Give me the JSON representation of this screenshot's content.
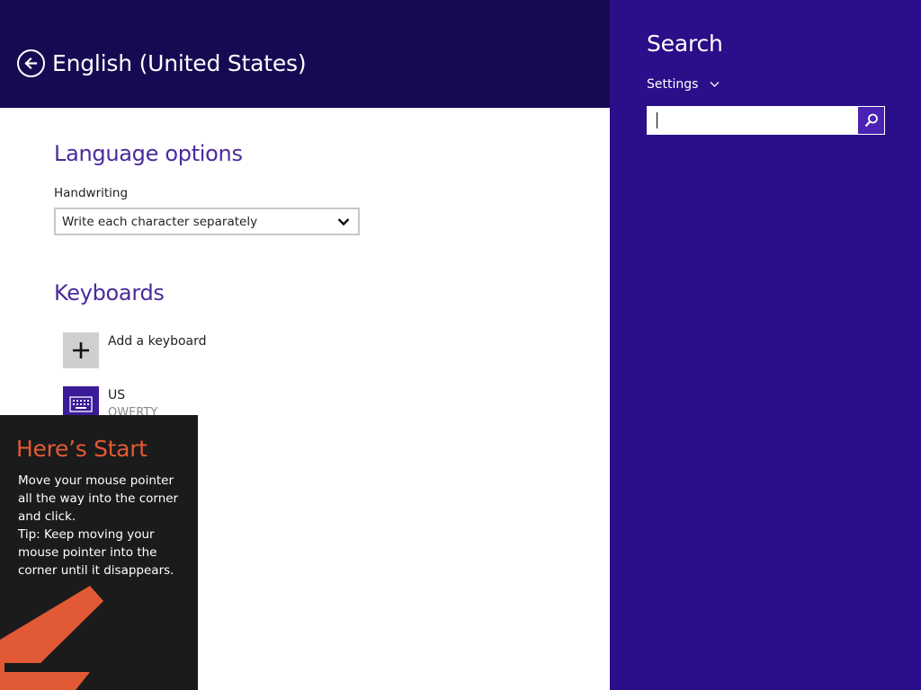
{
  "header": {
    "title": "English (United States)",
    "back_icon": "back-arrow-icon",
    "background": "#180a52"
  },
  "language_options": {
    "heading": "Language options",
    "handwriting": {
      "label": "Handwriting",
      "selected": "Write each character separately"
    }
  },
  "keyboards": {
    "heading": "Keyboards",
    "items": [
      {
        "title": "Add a keyboard",
        "subtitle": "",
        "icon": "plus-icon"
      },
      {
        "title": "US",
        "subtitle": "QWERTY",
        "icon": "keyboard-icon"
      }
    ]
  },
  "tip": {
    "title": "Here’s Start",
    "body_lines": [
      "Move your mouse pointer",
      "all the way into the corner",
      "and click.",
      "Tip: Keep moving your",
      "mouse pointer into the",
      "corner until it disappears."
    ],
    "accent": "#e25a35",
    "arrow_icon": "corner-arrow-icon"
  },
  "charm": {
    "title": "Search",
    "scope": "Settings",
    "search_value": "",
    "background": "#2b0e8a",
    "accent": "#4b22b4"
  }
}
